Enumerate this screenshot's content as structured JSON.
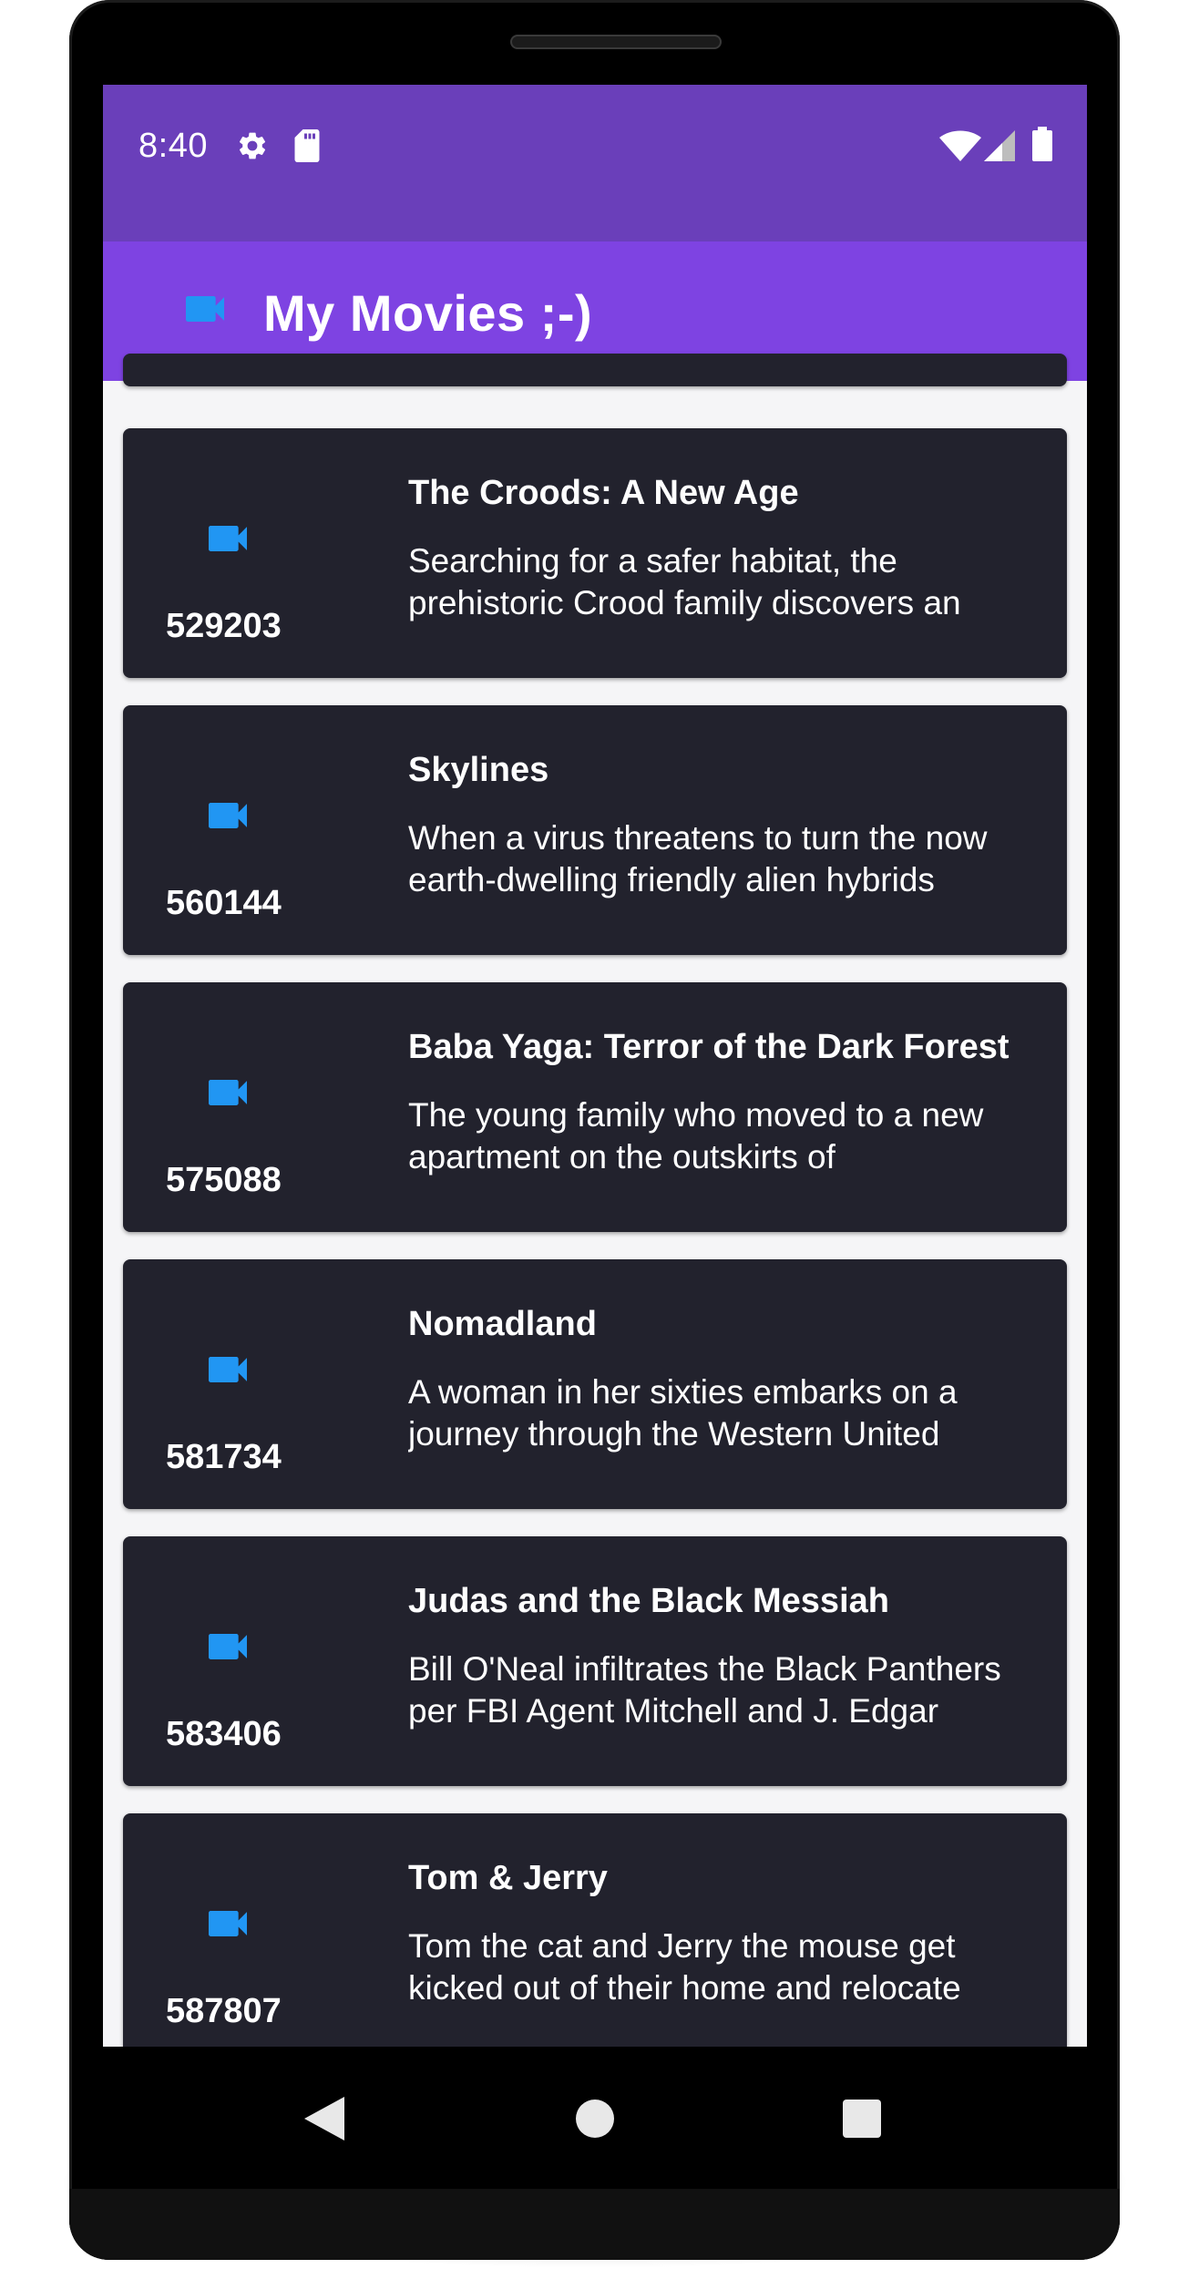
{
  "status_bar": {
    "time": "8:40",
    "icons": [
      "settings-icon",
      "sd-card-icon",
      "wifi-icon",
      "signal-icon",
      "battery-icon"
    ]
  },
  "app_bar": {
    "title": "My Movies ;-)",
    "logo_icon": "videocam-icon"
  },
  "movies": [
    {
      "id": "529203",
      "title": "The Croods: A New Age",
      "overview": "Searching for a safer habitat, the prehistoric Crood family discovers an"
    },
    {
      "id": "560144",
      "title": "Skylines",
      "overview": "When a virus threatens to turn the now earth-dwelling friendly alien hybrids"
    },
    {
      "id": "575088",
      "title": "Baba Yaga: Terror of the Dark Forest",
      "overview": "The young family who moved to a new apartment on the outskirts of"
    },
    {
      "id": "581734",
      "title": "Nomadland",
      "overview": "A woman in her sixties embarks on a journey through the Western United"
    },
    {
      "id": "583406",
      "title": "Judas and the Black Messiah",
      "overview": "Bill O'Neal infiltrates the Black Panthers per FBI Agent Mitchell and J. Edgar"
    },
    {
      "id": "587807",
      "title": "Tom & Jerry",
      "overview": "Tom the cat and Jerry the mouse get kicked out of their home and relocate"
    }
  ],
  "nav_bar": {
    "buttons": [
      "back-icon",
      "home-icon",
      "recents-icon"
    ]
  },
  "colors": {
    "status_bar": "#6a3fba",
    "app_bar": "#7e43e2",
    "card": "#22222d",
    "icon_accent": "#2196f3"
  }
}
